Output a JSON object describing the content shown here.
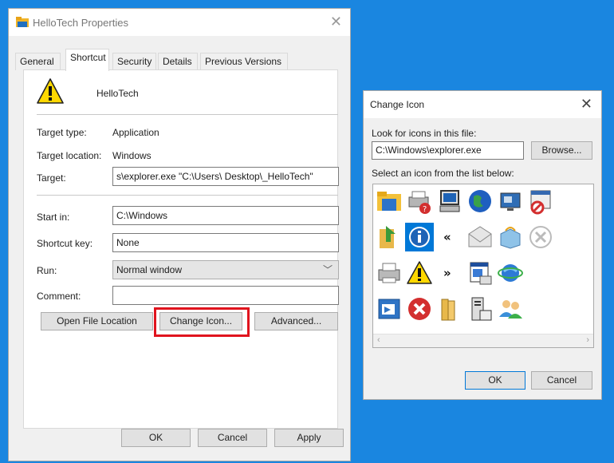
{
  "properties": {
    "title": "HelloTech Properties",
    "tabs": [
      "General",
      "Shortcut",
      "Security",
      "Details",
      "Previous Versions"
    ],
    "active_tab": "Shortcut",
    "name": "HelloTech",
    "target_type_label": "Target type:",
    "target_type_value": "Application",
    "target_location_label": "Target location:",
    "target_location_value": "Windows",
    "target_label": "Target:",
    "target_value": "s\\explorer.exe \"C:\\Users\\         Desktop\\_HelloTech\"",
    "start_in_label": "Start in:",
    "start_in_value": "C:\\Windows",
    "shortcut_key_label": "Shortcut key:",
    "shortcut_key_value": "None",
    "run_label": "Run:",
    "run_value": "Normal window",
    "comment_label": "Comment:",
    "comment_value": "",
    "open_file_location": "Open File Location",
    "change_icon": "Change Icon...",
    "advanced": "Advanced...",
    "ok": "OK",
    "cancel": "Cancel",
    "apply": "Apply"
  },
  "change_icon_dialog": {
    "title": "Change Icon",
    "look_label": "Look for icons in this file:",
    "file_value": "C:\\Windows\\explorer.exe",
    "browse": "Browse...",
    "select_label": "Select an icon from the list below:",
    "ok": "OK",
    "cancel": "Cancel",
    "icons": [
      [
        "folder-icon",
        "printer-help-icon",
        "computer-icon",
        "globe-icon",
        "monitor-icon",
        "blocked-window-icon"
      ],
      [
        "folder-arrow-icon",
        "info-icon",
        "double-left-arrow-icon",
        "mail-icon",
        "package-icon",
        "cancel-circle-icon"
      ],
      [
        "printer-icon",
        "warning-icon",
        "double-right-arrow-icon",
        "document-window-icon",
        "ie-globe-icon"
      ],
      [
        "app-window-icon",
        "error-icon",
        "books-icon",
        "server-icon",
        "users-icon"
      ]
    ],
    "selected_icon": "info-icon"
  }
}
